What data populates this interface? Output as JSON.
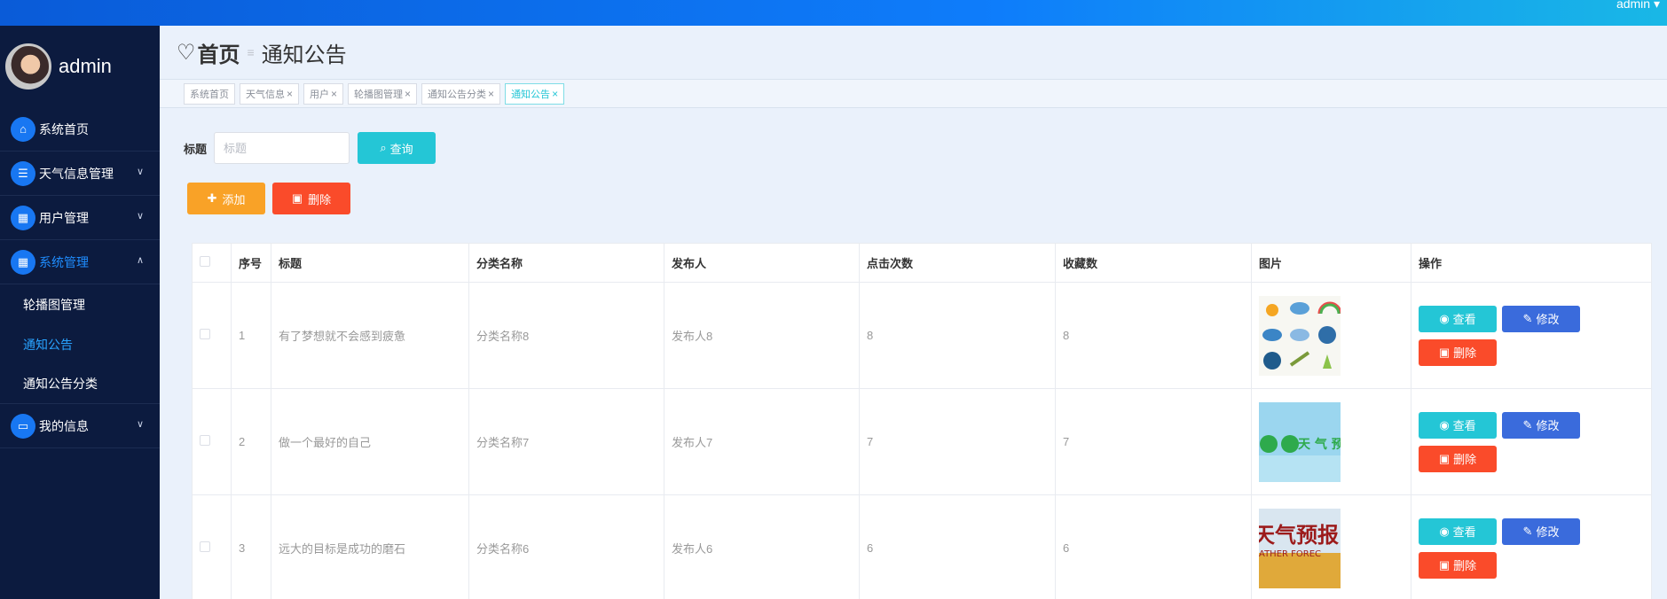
{
  "topbar": {
    "user": "admin ▾"
  },
  "sidebar": {
    "profile_name": "admin",
    "items": [
      {
        "label": "系统首页",
        "icon": "home-icon",
        "glyph": "⌂"
      },
      {
        "label": "天气信息管理",
        "icon": "sliders-icon",
        "glyph": "☰",
        "chevron": "∨"
      },
      {
        "label": "用户管理",
        "icon": "grid-icon",
        "glyph": "▦",
        "chevron": "∨"
      },
      {
        "label": "系统管理",
        "icon": "apps-icon",
        "glyph": "▦",
        "chevron": "∧",
        "active": true
      },
      {
        "label": "我的信息",
        "icon": "card-icon",
        "glyph": "▭",
        "chevron": "∨"
      }
    ],
    "sub_items": [
      {
        "label": "轮播图管理"
      },
      {
        "label": "通知公告",
        "active": true
      },
      {
        "label": "通知公告分类"
      }
    ]
  },
  "breadcrumb": {
    "heart": "♡",
    "home": "首页",
    "sep": "≡",
    "current": "通知公告"
  },
  "tags": [
    {
      "label": "系统首页",
      "closable": false
    },
    {
      "label": "天气信息",
      "closable": true
    },
    {
      "label": "用户",
      "closable": true
    },
    {
      "label": "轮播图管理",
      "closable": true
    },
    {
      "label": "通知公告分类",
      "closable": true
    },
    {
      "label": "通知公告",
      "closable": true,
      "active": true
    }
  ],
  "search": {
    "label": "标题",
    "placeholder": "标题",
    "button": "查询"
  },
  "actions": {
    "add": "添加",
    "delete": "删除"
  },
  "table": {
    "headers": [
      "序号",
      "标题",
      "分类名称",
      "发布人",
      "点击次数",
      "收藏数",
      "图片",
      "操作"
    ],
    "rows": [
      {
        "index": "1",
        "title": "有了梦想就不会感到疲惫",
        "category": "分类名称8",
        "publisher": "发布人8",
        "clicks": "8",
        "favorites": "8",
        "image": "weather-icons"
      },
      {
        "index": "2",
        "title": "做一个最好的自己",
        "category": "分类名称7",
        "publisher": "发布人7",
        "clicks": "7",
        "favorites": "7",
        "image": "weather-forecast-green",
        "image_text": "天 气 预报"
      },
      {
        "index": "3",
        "title": "远大的目标是成功的磨石",
        "category": "分类名称6",
        "publisher": "发布人6",
        "clicks": "6",
        "favorites": "6",
        "image": "weather-forecast-field",
        "image_text": "天气预报",
        "image_subtext": "ATHER FOREC"
      }
    ],
    "ops": {
      "view": "查看",
      "edit": "修改",
      "delete": "删除"
    }
  },
  "colors": {
    "accent": "#24c6d6",
    "warning": "#f9a227",
    "danger": "#fa4b2a",
    "primary": "#3a6bdc",
    "sidebar": "#0c1b3f"
  }
}
